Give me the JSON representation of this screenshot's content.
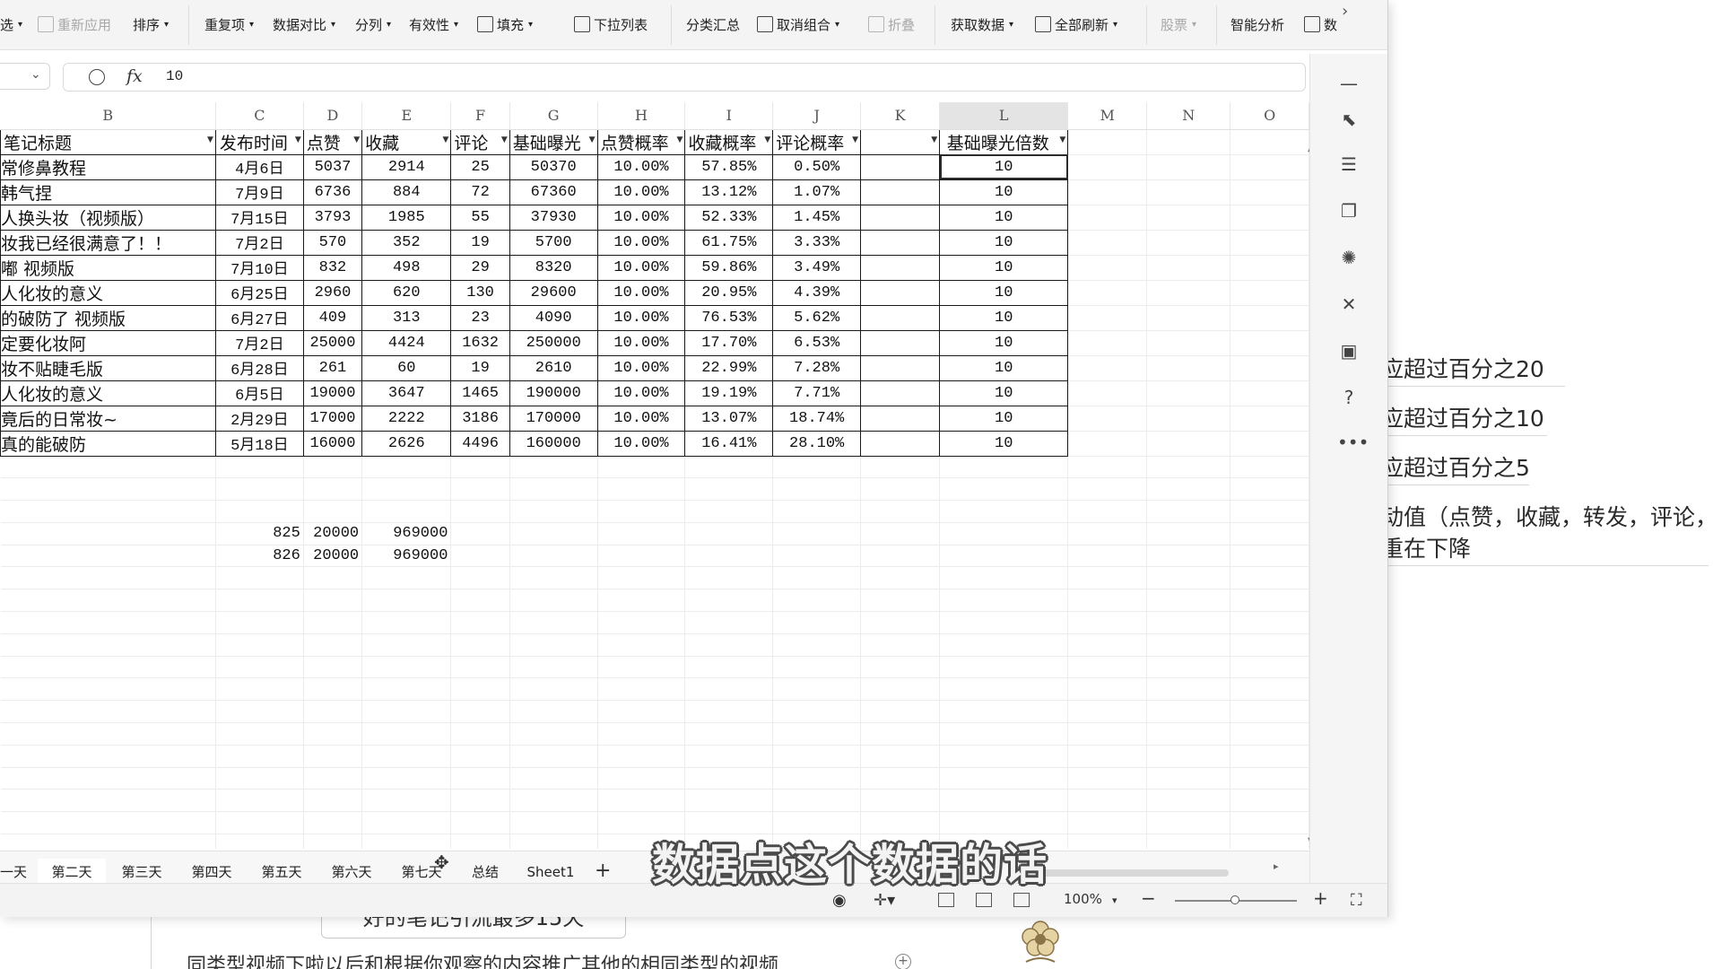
{
  "ribbon": {
    "items": [
      {
        "label": "选",
        "dim": false
      },
      {
        "label": "重新应用",
        "dim": true
      },
      {
        "label": "排序",
        "dim": false
      },
      {
        "label": "重复项",
        "dim": false
      },
      {
        "label": "数据对比",
        "dim": false
      },
      {
        "label": "分列",
        "dim": false
      },
      {
        "label": "有效性",
        "dim": false
      },
      {
        "label": "填充",
        "dim": false
      },
      {
        "label": "下拉列表",
        "dim": false
      },
      {
        "label": "分类汇总",
        "dim": false
      },
      {
        "label": "取消组合",
        "dim": false
      },
      {
        "label": "折叠",
        "dim": true
      },
      {
        "label": "获取数据",
        "dim": false
      },
      {
        "label": "全部刷新",
        "dim": false
      },
      {
        "label": "股票",
        "dim": true
      },
      {
        "label": "智能分析",
        "dim": false
      },
      {
        "label": "数",
        "dim": false
      }
    ]
  },
  "formula_bar": {
    "fx": "fx",
    "value": "10"
  },
  "grid": {
    "columns": [
      "B",
      "C",
      "D",
      "E",
      "F",
      "G",
      "H",
      "I",
      "J",
      "K",
      "L",
      "M",
      "N",
      "O"
    ],
    "headers": [
      "笔记标题",
      "发布时间",
      "点赞",
      "收藏",
      "评论",
      "基础曝光",
      "点赞概率",
      "收藏概率",
      "评论概率",
      "",
      "基础曝光倍数"
    ],
    "rows": [
      [
        "常修鼻教程",
        "4月6日",
        "5037",
        "2914",
        "25",
        "50370",
        "10.00%",
        "57.85%",
        "0.50%",
        "",
        "10"
      ],
      [
        "韩气捏",
        "7月9日",
        "6736",
        "884",
        "72",
        "67360",
        "10.00%",
        "13.12%",
        "1.07%",
        "",
        "10"
      ],
      [
        "人换头妆（视频版）",
        "7月15日",
        "3793",
        "1985",
        "55",
        "37930",
        "10.00%",
        "52.33%",
        "1.45%",
        "",
        "10"
      ],
      [
        "妆我已经很满意了！！",
        "7月2日",
        "570",
        "352",
        "19",
        "5700",
        "10.00%",
        "61.75%",
        "3.33%",
        "",
        "10"
      ],
      [
        "嘟 视频版",
        "7月10日",
        "832",
        "498",
        "29",
        "8320",
        "10.00%",
        "59.86%",
        "3.49%",
        "",
        "10"
      ],
      [
        "人化妆的意义",
        "6月25日",
        "2960",
        "620",
        "130",
        "29600",
        "10.00%",
        "20.95%",
        "4.39%",
        "",
        "10"
      ],
      [
        "的破防了 视频版",
        "6月27日",
        "409",
        "313",
        "23",
        "4090",
        "10.00%",
        "76.53%",
        "5.62%",
        "",
        "10"
      ],
      [
        "定要化妆阿",
        "7月2日",
        "25000",
        "4424",
        "1632",
        "250000",
        "10.00%",
        "17.70%",
        "6.53%",
        "",
        "10"
      ],
      [
        "妆不贴睫毛版",
        "6月28日",
        "261",
        "60",
        "19",
        "2610",
        "10.00%",
        "22.99%",
        "7.28%",
        "",
        "10"
      ],
      [
        "人化妆的意义",
        "6月5日",
        "19000",
        "3647",
        "1465",
        "190000",
        "10.00%",
        "19.19%",
        "7.71%",
        "",
        "10"
      ],
      [
        "竟后的日常妆~",
        "2月29日",
        "17000",
        "2222",
        "3186",
        "170000",
        "10.00%",
        "13.07%",
        "18.74%",
        "",
        "10"
      ],
      [
        "真的能破防",
        "5月18日",
        "16000",
        "2626",
        "4496",
        "160000",
        "10.00%",
        "16.41%",
        "28.10%",
        "",
        "10"
      ]
    ],
    "extra_rows": [
      [
        "825",
        "20000",
        "969000"
      ],
      [
        "826",
        "20000",
        "969000"
      ]
    ]
  },
  "sheet_tabs": {
    "tabs": [
      "一天",
      "第二天",
      "第三天",
      "第四天",
      "第五天",
      "第六天",
      "第七天",
      "总结",
      "Sheet1"
    ],
    "active": "第二天",
    "add": "+"
  },
  "status_bar": {
    "zoom": "100%",
    "minus": "−",
    "plus": "+"
  },
  "right_panel": {
    "icons": [
      "minimize-icon",
      "pointer-icon",
      "sliders-icon",
      "layers-icon",
      "ai-icon",
      "tools-icon",
      "book-icon",
      "help-icon",
      "more-icon"
    ]
  },
  "background_doc": {
    "notes": [
      "应超过百分之20",
      "应超过百分之10",
      "应超过百分之5",
      "动值（点赞，收藏，转发，评论，",
      "重在下降"
    ],
    "bottom_box": "好的笔记引流最多15天",
    "bottom_text": "同类型视频下啦以后和根据你观察的内容推广其他的相同类型的视频",
    "plus": "+"
  },
  "subtitle": "数据点这个数据的话",
  "colors": {
    "accent": "#2f6f3f",
    "border": "#1a1a1a",
    "ribbon_bg": "#f4f4f5"
  }
}
